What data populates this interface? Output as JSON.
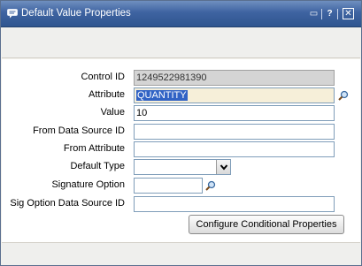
{
  "window": {
    "title": "Default Value Properties",
    "controls": {
      "maximize": "▭",
      "help": "?",
      "close": "✕"
    }
  },
  "form": {
    "control_id": {
      "label": "Control ID",
      "value": "1249522981390"
    },
    "attribute": {
      "label": "Attribute",
      "value": "QUANTITY",
      "icon": "magnifier-icon"
    },
    "value": {
      "label": "Value",
      "value": "10"
    },
    "from_data_source_id": {
      "label": "From Data Source ID",
      "value": ""
    },
    "from_attribute": {
      "label": "From Attribute",
      "value": ""
    },
    "default_type": {
      "label": "Default Type",
      "value": ""
    },
    "signature_option": {
      "label": "Signature Option",
      "value": "",
      "icon": "magnifier-icon"
    },
    "sig_option_data_source_id": {
      "label": "Sig Option Data Source ID",
      "value": ""
    }
  },
  "buttons": {
    "configure": "Configure Conditional Properties"
  },
  "colors": {
    "title_bar": "#3e63a1",
    "selection": "#3163c5",
    "readonly_field": "#d4d4d4"
  }
}
